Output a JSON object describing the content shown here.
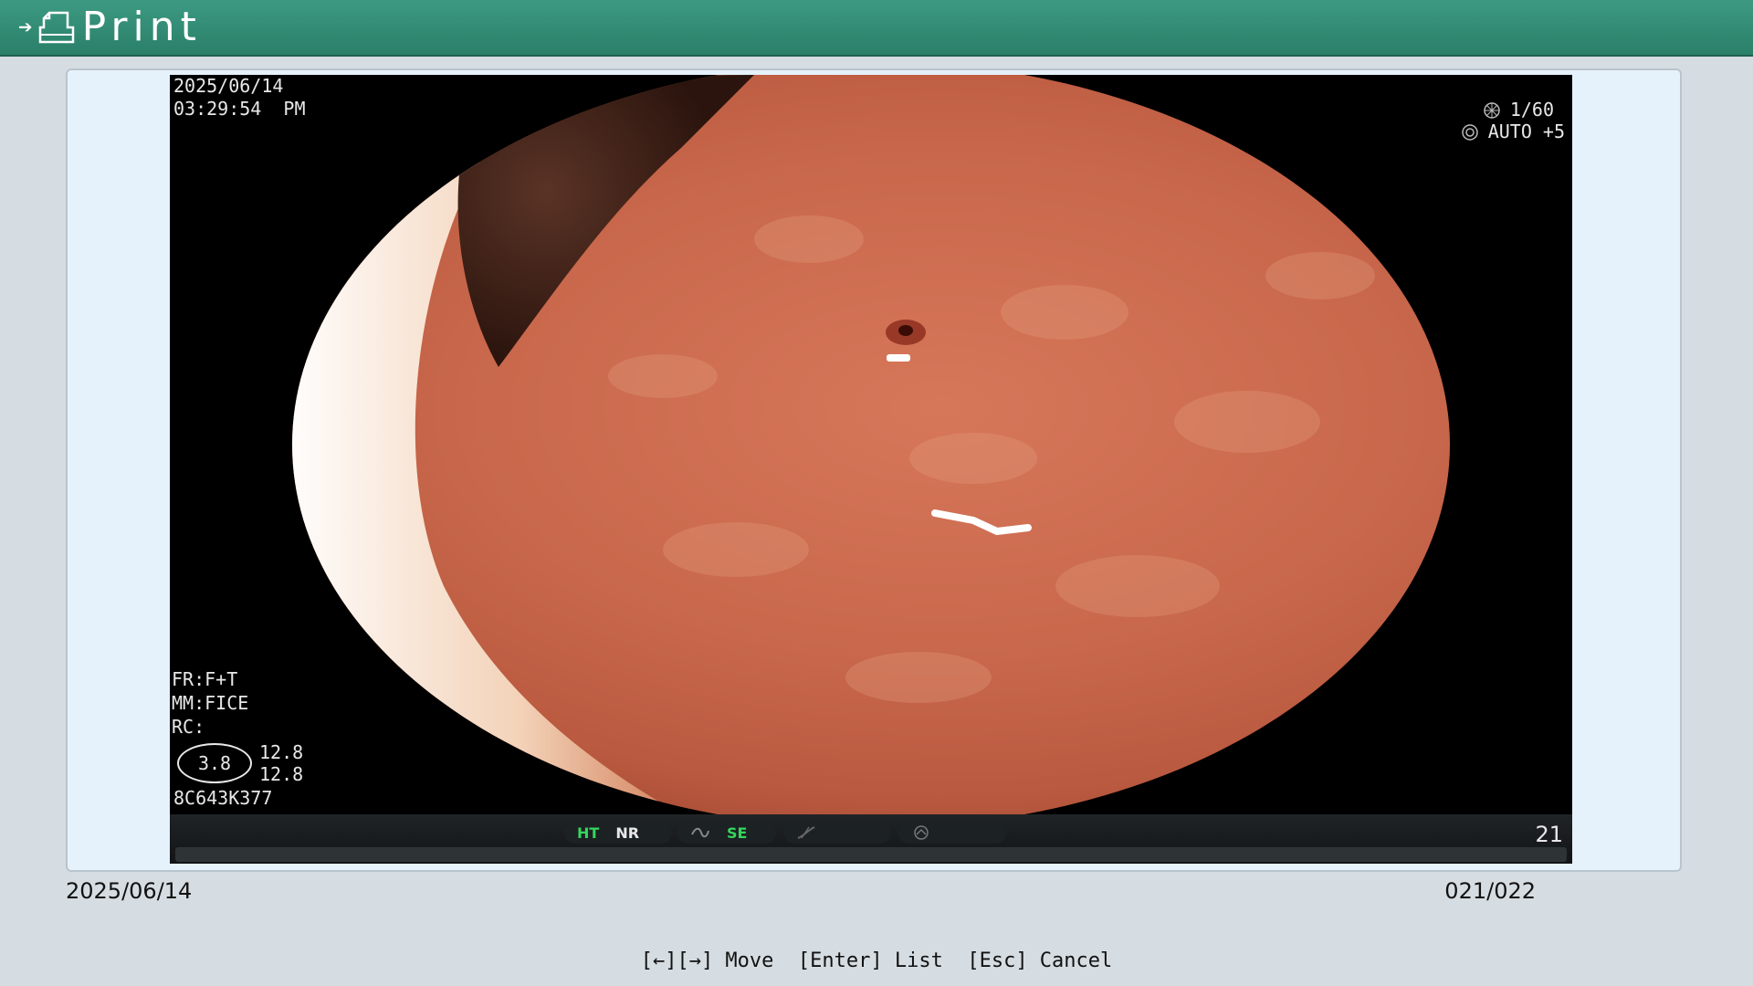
{
  "header": {
    "title": "Print",
    "arrow_icon": "arrow-right-icon",
    "doc_icon": "document-icon"
  },
  "video": {
    "date": "2025/06/14",
    "time": "03:29:54  PM",
    "shutter": "1/60",
    "iris": "AUTO +5",
    "fr": "FR:F+T",
    "mm": "MM:FICE",
    "rc": "RC:",
    "zoom": "3.8",
    "zoom_value_1": "12.8",
    "zoom_value_2": "12.8",
    "serial": "8C643K377",
    "status": {
      "ht": "HT",
      "nr": "NR",
      "se": "SE",
      "frame_number": "21"
    }
  },
  "footer": {
    "date": "2025/06/14",
    "page": "021/022",
    "hints": "[←][→] Move  [Enter] List  [Esc] Cancel"
  },
  "colors": {
    "title_bar": "#2f8a72",
    "panel_bg": "#e6f2fb",
    "page_bg": "#d6dde2",
    "status_green": "#36d65c"
  }
}
